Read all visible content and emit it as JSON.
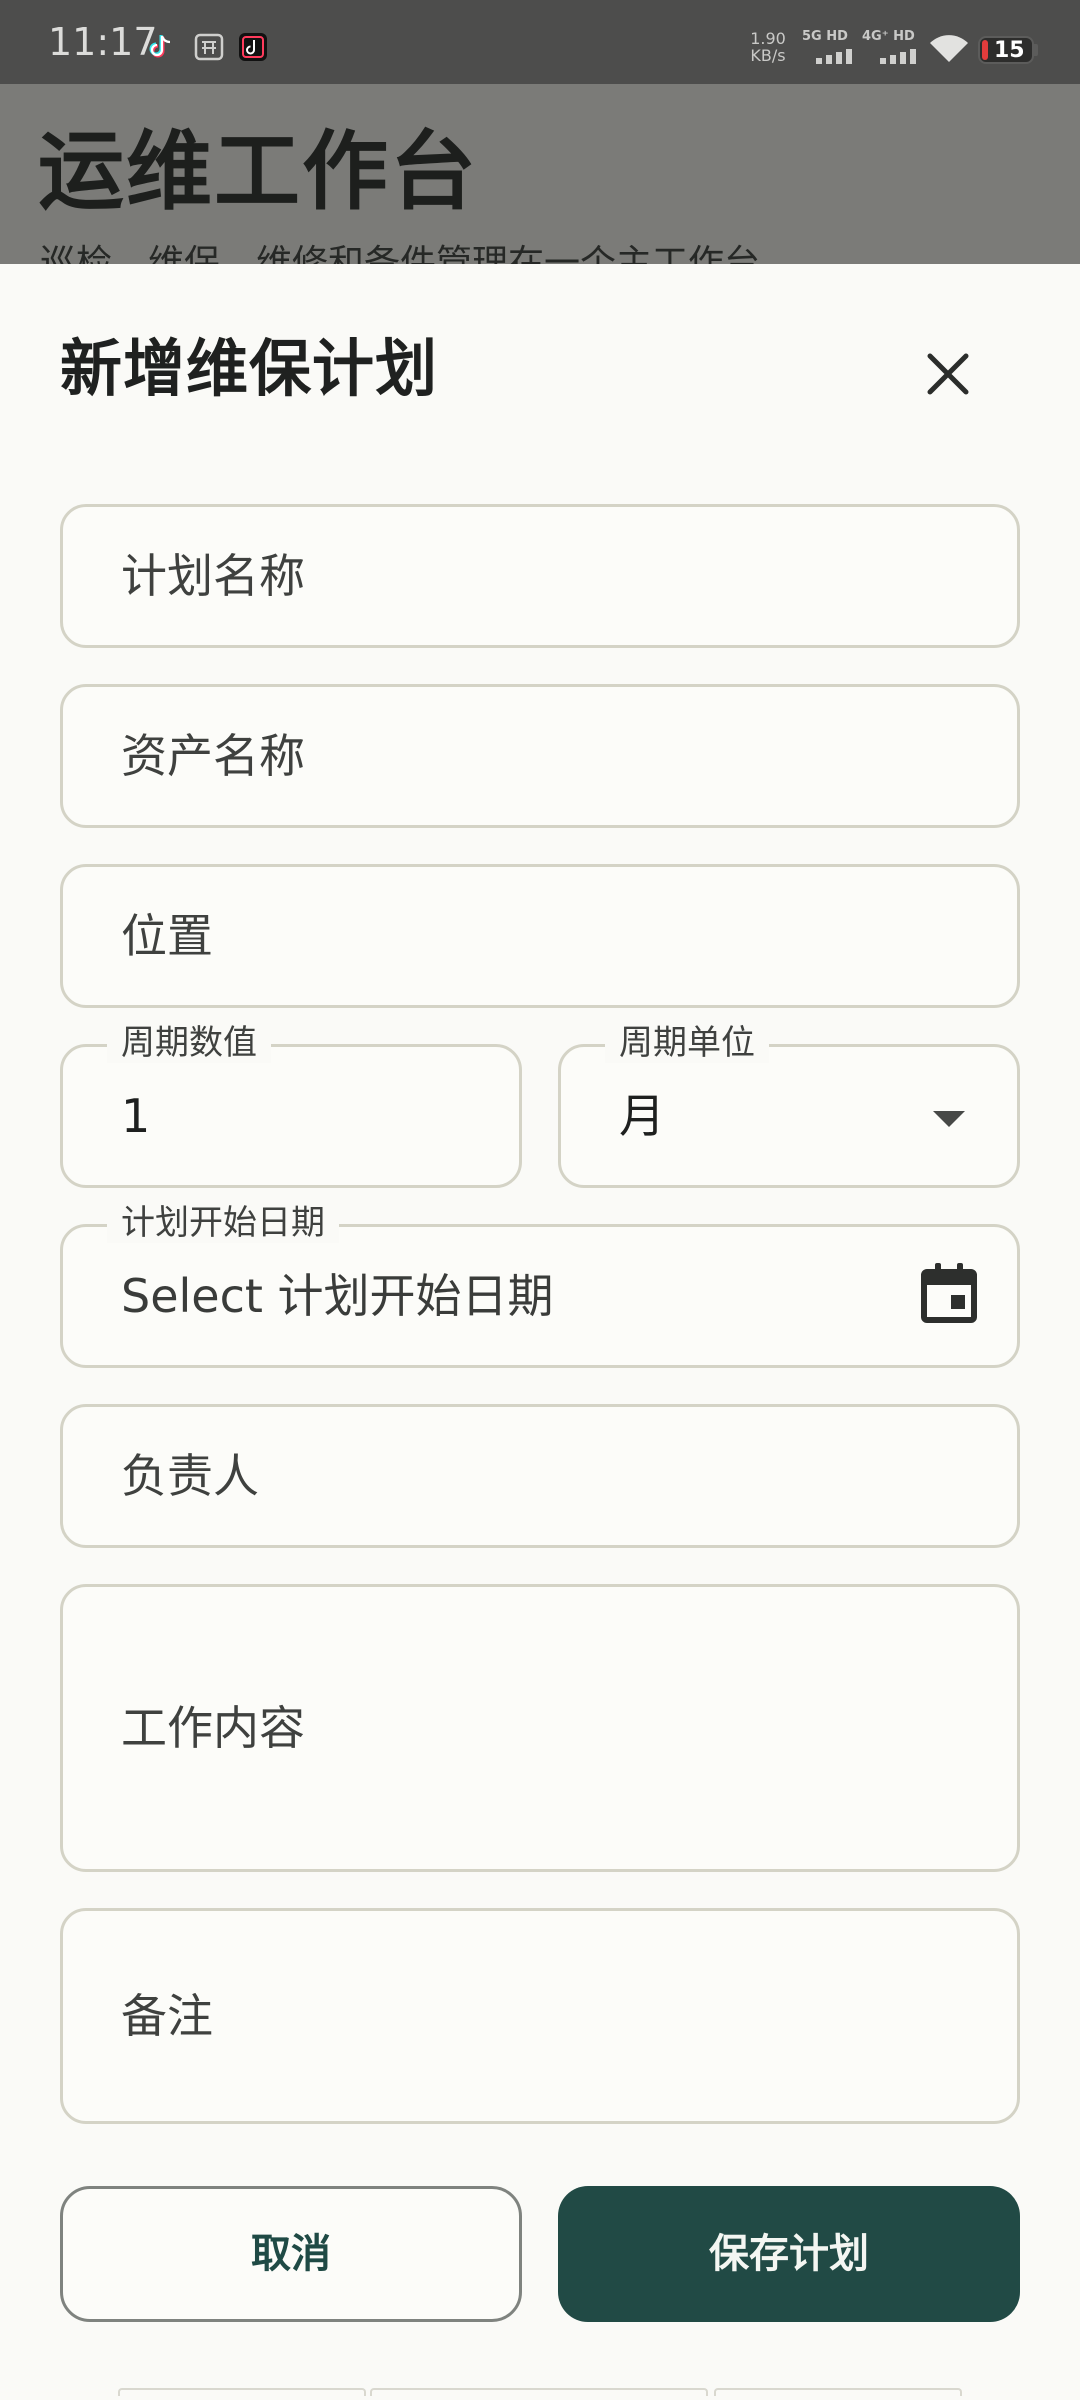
{
  "status_bar": {
    "time": "11:17",
    "app_icons": [
      "tiktok-icon",
      "app-store-icon",
      "tiktok-lite-icon"
    ],
    "net_speed_value": "1.90",
    "net_speed_unit": "KB/s",
    "signal_1_label": "5G HD",
    "signal_2_label": "4G⁺ HD",
    "battery_level": "15",
    "battery_color": "#e23c3c"
  },
  "background_page": {
    "title": "运维工作台",
    "subtitle": "巡检、维保、维修和备件管理在一个主工作台。"
  },
  "dialog": {
    "title": "新增维保计划",
    "fields": {
      "plan_name": {
        "placeholder": "计划名称"
      },
      "asset_name": {
        "placeholder": "资产名称"
      },
      "location": {
        "placeholder": "位置"
      },
      "cycle_value": {
        "label": "周期数值",
        "value": "1"
      },
      "cycle_unit": {
        "label": "周期单位",
        "value": "月"
      },
      "start_date": {
        "label": "计划开始日期",
        "value": "Select 计划开始日期"
      },
      "owner": {
        "placeholder": "负责人"
      },
      "work_content": {
        "placeholder": "工作内容"
      },
      "notes": {
        "placeholder": "备注"
      }
    },
    "buttons": {
      "cancel": "取消",
      "save": "保存计划"
    }
  },
  "colors": {
    "accent": "#214a45",
    "field_border": "#d4d3c6",
    "sheet_background": "#fafaf7"
  }
}
